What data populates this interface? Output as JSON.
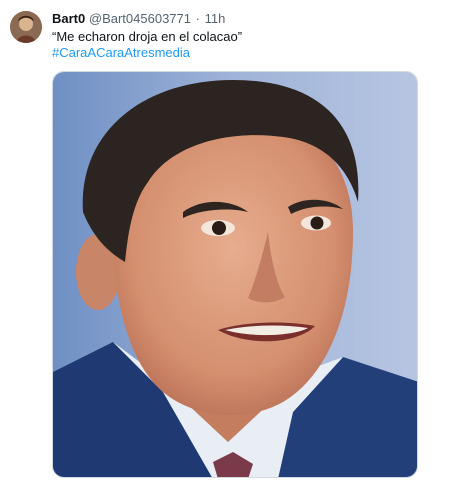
{
  "tweet": {
    "display_name": "Bart0",
    "handle": "@Bart045603771",
    "separator": "·",
    "time": "11h",
    "text": "“Me echaron droja en el colacao”",
    "hashtag": "#CaraACaraAtresmedia",
    "avatar_icon": "user-avatar-icon",
    "media_description_icon": "photo-icon"
  },
  "colors": {
    "link": "#1d9bf0",
    "secondary_text": "#536471",
    "primary_text": "#0f1419"
  }
}
